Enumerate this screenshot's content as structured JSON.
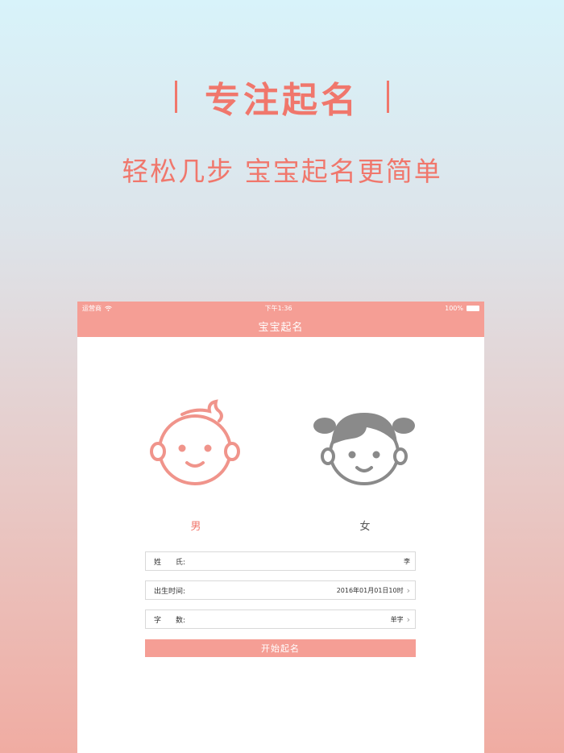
{
  "promo": {
    "headline": "专注起名",
    "subline": "轻松几步 宝宝起名更简单"
  },
  "status_bar": {
    "carrier": "运营商",
    "time": "下午1:36",
    "battery": "100%"
  },
  "nav": {
    "title": "宝宝起名"
  },
  "gender": {
    "boy_label": "男",
    "girl_label": "女",
    "selected": "男"
  },
  "form": {
    "surname": {
      "label": "姓　　氏:",
      "value": "李"
    },
    "birth": {
      "label": "出生时间:",
      "value": "2016年01月01日10时"
    },
    "count": {
      "label": "字　　数:",
      "value": "单字"
    }
  },
  "start_button": {
    "label": "开始起名"
  },
  "colors": {
    "accent": "#f0776c",
    "bar": "#f59e95",
    "girl_icon": "#8a8a8a"
  }
}
